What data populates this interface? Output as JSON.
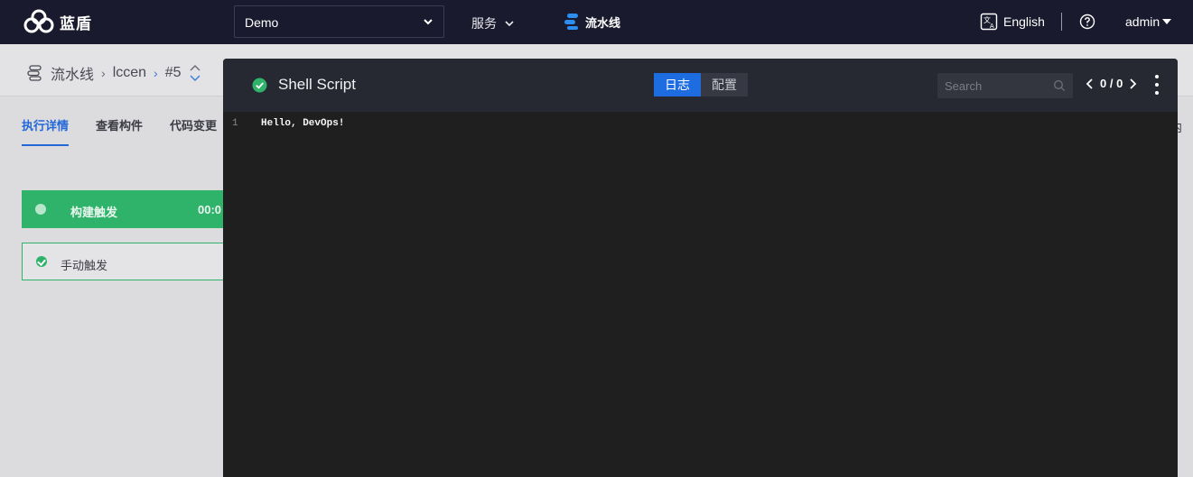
{
  "header": {
    "logo_text": "蓝盾",
    "project_select": {
      "value": "Demo"
    },
    "services_label": "服务",
    "pipeline_label": "流水线",
    "language_label": "English",
    "user_label": "admin"
  },
  "breadcrumb": {
    "items": [
      "流水线",
      "lccen",
      "#5"
    ]
  },
  "tabs": [
    "执行详情",
    "查看构件",
    "代码变更"
  ],
  "tabs_overflow_fragment": "内",
  "stage": {
    "name": "构建触发",
    "time": "00:0"
  },
  "step": {
    "name": "手动触发"
  },
  "log_panel": {
    "title": "Shell Script",
    "tabs": {
      "log": "日志",
      "config": "配置"
    },
    "search_placeholder": "Search",
    "pager": "0 / 0",
    "lines": [
      {
        "num": "1",
        "text": "Hello, DevOps!"
      }
    ]
  },
  "colors": {
    "topbar": "#1a1a2e",
    "accent": "#1e6de0",
    "success": "#2fb36a",
    "panel_bg": "#1f1f1f"
  }
}
